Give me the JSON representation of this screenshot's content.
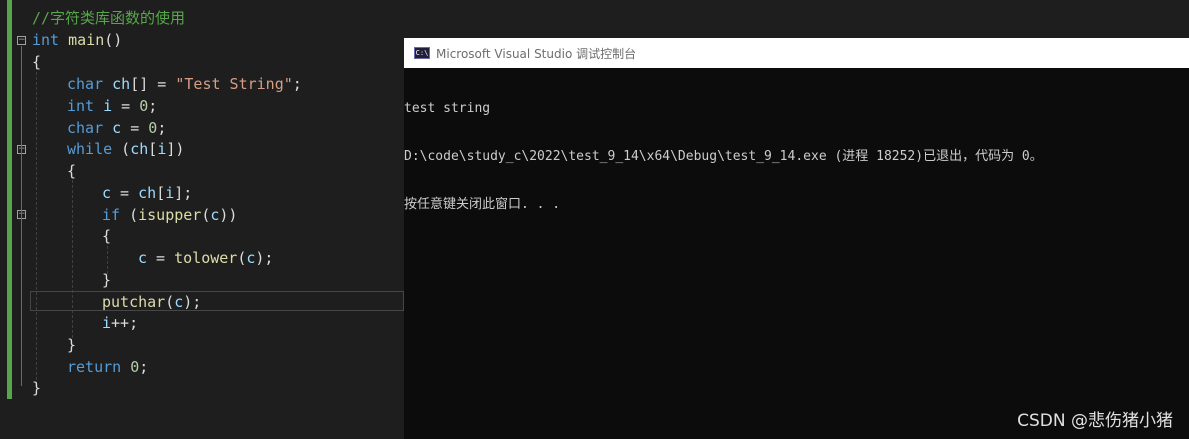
{
  "editor": {
    "comment": "//字符类库函数的使用",
    "lines": {
      "main_sig": "int main()",
      "open_brace": "{",
      "char_ch": [
        "char ",
        "ch",
        "[] = ",
        "\"Test String\"",
        ";"
      ],
      "int_i": [
        "int ",
        "i",
        " = ",
        "0",
        ";"
      ],
      "char_c": [
        "char ",
        "c",
        " = ",
        "0",
        ";"
      ],
      "while": [
        "while",
        " (",
        "ch",
        "[",
        "i",
        "])"
      ],
      "while_open": "{",
      "assign": [
        "c",
        " = ",
        "ch",
        "[",
        "i",
        "];"
      ],
      "if": [
        "if",
        " (",
        "isupper",
        "(",
        "c",
        "))"
      ],
      "if_open": "{",
      "lower": [
        "c",
        " = ",
        "tolower",
        "(",
        "c",
        ");"
      ],
      "if_close": "}",
      "putchar": [
        "putchar",
        "(",
        "c",
        ");"
      ],
      "incr": [
        "i",
        "++;"
      ],
      "while_close": "}",
      "return": [
        "return ",
        "0",
        ";"
      ],
      "close_brace": "}"
    }
  },
  "console": {
    "icon": "C:\\",
    "title": "Microsoft Visual Studio 调试控制台",
    "output": [
      "test string",
      "D:\\code\\study_c\\2022\\test_9_14\\x64\\Debug\\test_9_14.exe (进程 18252)已退出，代码为 0。",
      "按任意键关闭此窗口. . ."
    ]
  },
  "watermark": "CSDN @悲伤猪小猪",
  "colors": {
    "editor_bg": "#1e1e1e",
    "keyword": "#569cd6",
    "function": "#dcdcaa",
    "variable": "#9cdcfe",
    "number": "#b5cea8",
    "string": "#d69d85",
    "comment": "#57a64a",
    "console_bg": "#0c0c0c"
  }
}
